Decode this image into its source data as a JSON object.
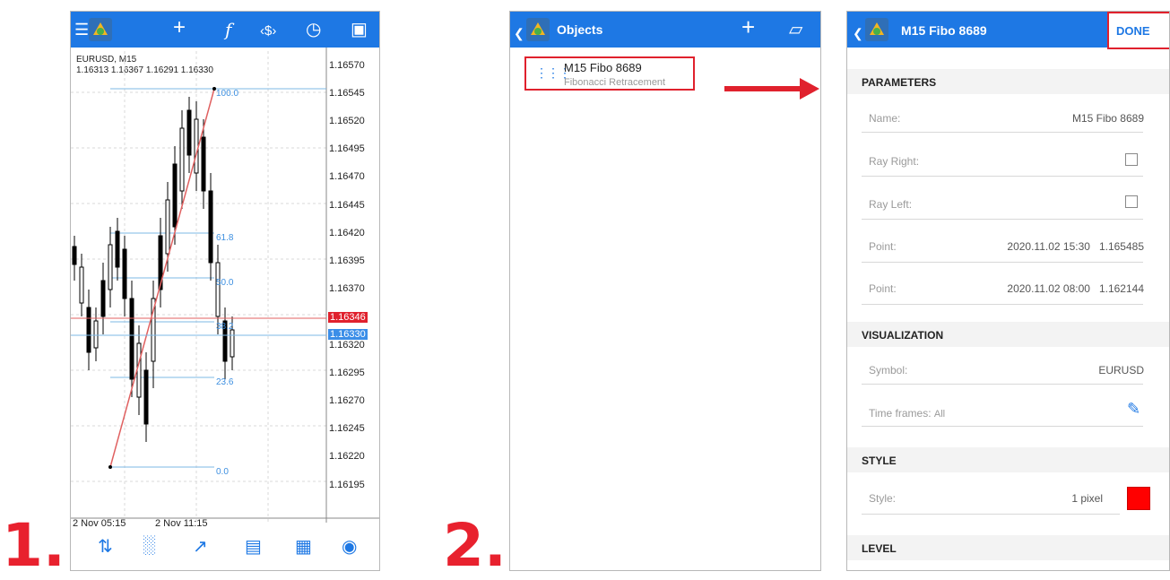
{
  "step1": {
    "number": "1."
  },
  "step2": {
    "number": "2."
  },
  "chart": {
    "symbol_line": "EURUSD, M15",
    "ohlc_line": "1.16313 1.16367 1.16291 1.16330",
    "price_labels": [
      "1.16570",
      "1.16545",
      "1.16520",
      "1.16495",
      "1.16470",
      "1.16445",
      "1.16420",
      "1.16395",
      "1.16370",
      "1.16346",
      "1.16330",
      "1.16320",
      "1.16295",
      "1.16270",
      "1.16245",
      "1.16220",
      "1.16195"
    ],
    "fibo_levels": [
      "100.0",
      "61.8",
      "50.0",
      "38.2",
      "23.6",
      "0.0"
    ],
    "time_labels": [
      "2 Nov 05:15",
      "2 Nov 11:15"
    ],
    "current_price_red": "1.16346",
    "current_price_blue": "1.16330",
    "colors": {
      "topbar": "#1e78e4",
      "trendline": "#e06060",
      "fibo": "#5ab0e0",
      "price_red": "#e0212d",
      "price_blue": "#3b8ee8"
    },
    "toolbar_icons": [
      "menu-icon",
      "crosshair-icon",
      "function-icon",
      "trade-icon",
      "clock-icon",
      "new-file-icon"
    ],
    "bottom_nav_icons": [
      "quotes-icon",
      "chart-icon",
      "trade-icon",
      "history-icon",
      "news-icon",
      "messages-icon"
    ]
  },
  "objects_screen": {
    "title": "Objects",
    "add_icon": "plus-icon",
    "delete_icon": "trash-icon",
    "items": [
      {
        "name": "M15 Fibo 8689",
        "type": "Fibonacci Retracement"
      }
    ]
  },
  "detail_screen": {
    "title": "M15 Fibo 8689",
    "done_label": "DONE",
    "parameters_header": "PARAMETERS",
    "name_label": "Name:",
    "name_value": "M15 Fibo 8689",
    "ray_right_label": "Ray Right:",
    "ray_left_label": "Ray Left:",
    "point1_label": "Point:",
    "point1_value": "2020.11.02 15:30   1.165485",
    "point2_label": "Point:",
    "point2_value": "2020.11.02 08:00   1.162144",
    "visualization_header": "VISUALIZATION",
    "symbol_label": "Symbol:",
    "symbol_value": "EURUSD",
    "timeframes_label": "Time frames:",
    "timeframes_value": "All",
    "style_header": "STYLE",
    "style_label": "Style:",
    "style_value": "1 pixel",
    "style_color": "#ff0000",
    "level_header": "LEVEL"
  }
}
